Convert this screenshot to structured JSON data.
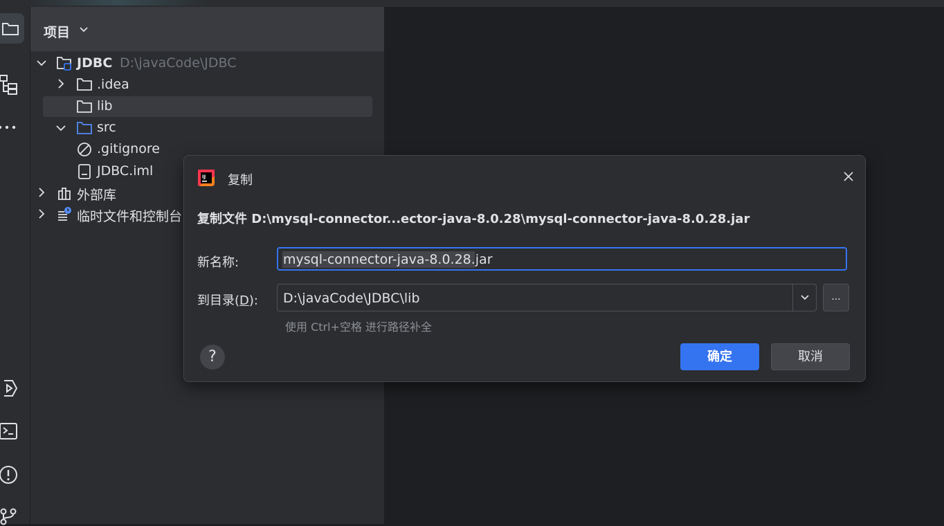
{
  "project_panel": {
    "title": "项目",
    "tree": [
      {
        "label": "JDBC",
        "path": "D:\\javaCode\\JDBC",
        "icon": "module-folder-icon",
        "expanded": true
      },
      {
        "label": ".idea",
        "icon": "folder-icon",
        "expanded": false
      },
      {
        "label": "lib",
        "icon": "folder-icon",
        "selected": true
      },
      {
        "label": "src",
        "icon": "source-folder-icon",
        "expanded": true
      },
      {
        "label": ".gitignore",
        "icon": "ignore-file-icon"
      },
      {
        "label": "JDBC.iml",
        "icon": "iml-file-icon"
      },
      {
        "label": "外部库",
        "icon": "library-icon",
        "expanded": false
      },
      {
        "label": "临时文件和控制台",
        "icon": "scratch-icon",
        "expanded": false
      }
    ]
  },
  "dialog": {
    "title": "复制",
    "heading": "复制文件 D:\\mysql-connector...ector-java-8.0.28\\mysql-connector-java-8.0.28.jar",
    "new_name_label": "新名称:",
    "new_name_selected": "mysql-connector-java-8.0.28",
    "new_name_ext": ".jar",
    "dir_label_prefix": "到目录(",
    "dir_label_mnemonic": "D",
    "dir_label_suffix": "):",
    "dir_value": "D:\\javaCode\\JDBC\\lib",
    "browse_label": "...",
    "hint": "使用 Ctrl+空格 进行路径补全",
    "help_label": "?",
    "ok_label": "确定",
    "cancel_label": "取消"
  },
  "colors": {
    "accent": "#3574f0",
    "panel_bg": "#2b2d30",
    "editor_bg": "#1e1f22"
  }
}
